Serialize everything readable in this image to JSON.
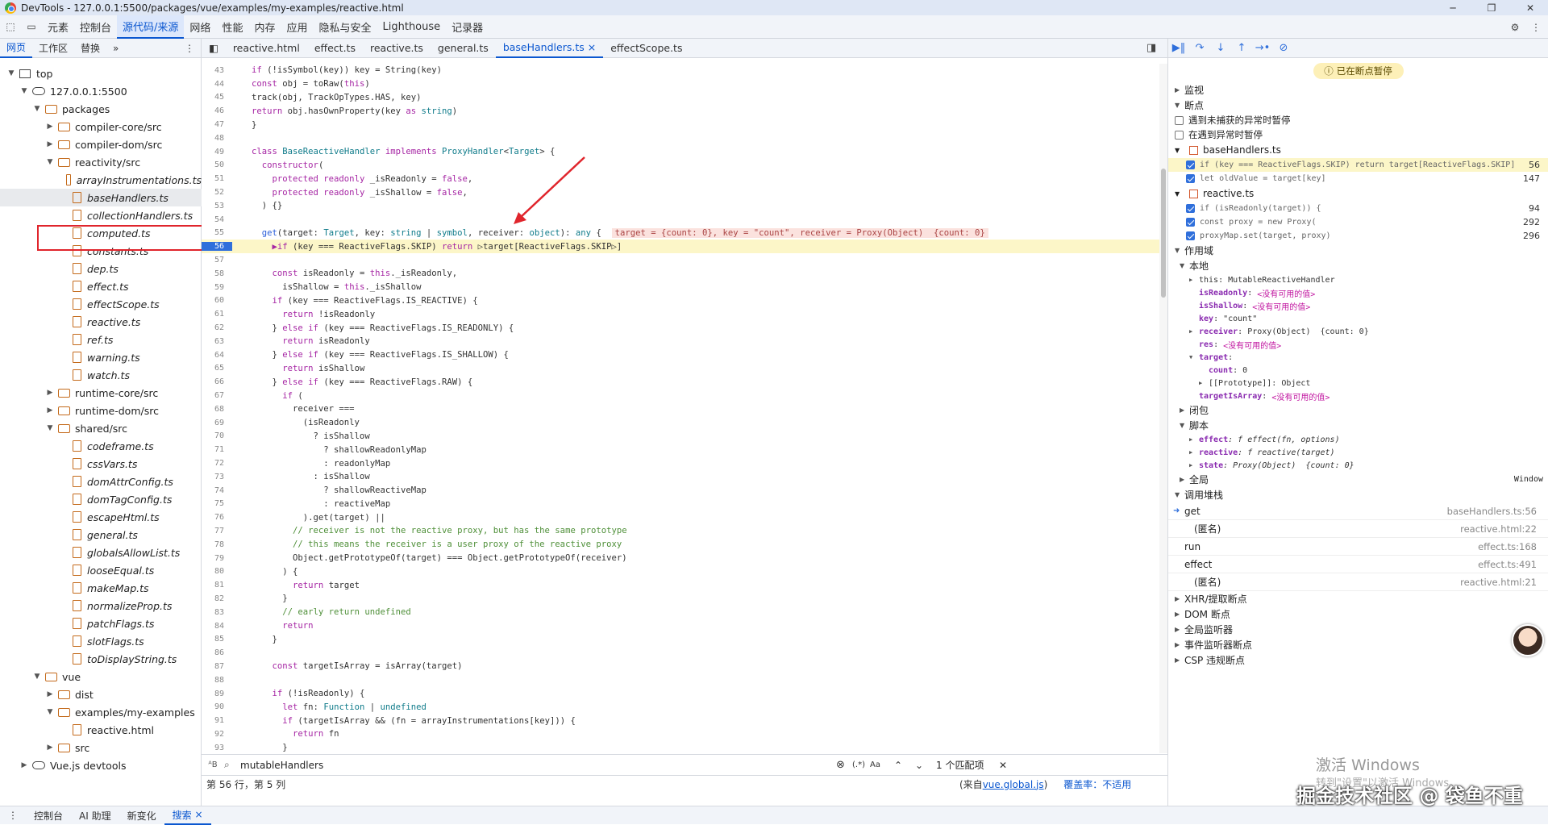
{
  "title": "DevTools - 127.0.0.1:5500/packages/vue/examples/my-examples/reactive.html",
  "main_tabs": [
    "元素",
    "控制台",
    "源代码/来源",
    "网络",
    "性能",
    "内存",
    "应用",
    "隐私与安全",
    "Lighthouse",
    "记录器"
  ],
  "sub_tabs": [
    "网页",
    "工作区",
    "替换"
  ],
  "tree": [
    {
      "label": "top",
      "depth": 0,
      "type": "frame",
      "arrow": "▼"
    },
    {
      "label": "127.0.0.1:5500",
      "depth": 1,
      "type": "cloud",
      "arrow": "▼"
    },
    {
      "label": "packages",
      "depth": 2,
      "type": "folder",
      "arrow": "▼"
    },
    {
      "label": "compiler-core/src",
      "depth": 3,
      "type": "folder",
      "arrow": "▶"
    },
    {
      "label": "compiler-dom/src",
      "depth": 3,
      "type": "folder",
      "arrow": "▶"
    },
    {
      "label": "reactivity/src",
      "depth": 3,
      "type": "folder",
      "arrow": "▼"
    },
    {
      "label": "arrayInstrumentations.ts",
      "depth": 4,
      "type": "file",
      "italic": true
    },
    {
      "label": "baseHandlers.ts",
      "depth": 4,
      "type": "file",
      "italic": true,
      "selected": true
    },
    {
      "label": "collectionHandlers.ts",
      "depth": 4,
      "type": "file",
      "italic": true
    },
    {
      "label": "computed.ts",
      "depth": 4,
      "type": "file",
      "italic": true
    },
    {
      "label": "constants.ts",
      "depth": 4,
      "type": "file",
      "italic": true
    },
    {
      "label": "dep.ts",
      "depth": 4,
      "type": "file",
      "italic": true
    },
    {
      "label": "effect.ts",
      "depth": 4,
      "type": "file",
      "italic": true
    },
    {
      "label": "effectScope.ts",
      "depth": 4,
      "type": "file",
      "italic": true
    },
    {
      "label": "reactive.ts",
      "depth": 4,
      "type": "file",
      "italic": true
    },
    {
      "label": "ref.ts",
      "depth": 4,
      "type": "file",
      "italic": true
    },
    {
      "label": "warning.ts",
      "depth": 4,
      "type": "file",
      "italic": true
    },
    {
      "label": "watch.ts",
      "depth": 4,
      "type": "file",
      "italic": true
    },
    {
      "label": "runtime-core/src",
      "depth": 3,
      "type": "folder",
      "arrow": "▶"
    },
    {
      "label": "runtime-dom/src",
      "depth": 3,
      "type": "folder",
      "arrow": "▶"
    },
    {
      "label": "shared/src",
      "depth": 3,
      "type": "folder",
      "arrow": "▼"
    },
    {
      "label": "codeframe.ts",
      "depth": 4,
      "type": "file",
      "italic": true
    },
    {
      "label": "cssVars.ts",
      "depth": 4,
      "type": "file",
      "italic": true
    },
    {
      "label": "domAttrConfig.ts",
      "depth": 4,
      "type": "file",
      "italic": true
    },
    {
      "label": "domTagConfig.ts",
      "depth": 4,
      "type": "file",
      "italic": true
    },
    {
      "label": "escapeHtml.ts",
      "depth": 4,
      "type": "file",
      "italic": true
    },
    {
      "label": "general.ts",
      "depth": 4,
      "type": "file",
      "italic": true
    },
    {
      "label": "globalsAllowList.ts",
      "depth": 4,
      "type": "file",
      "italic": true
    },
    {
      "label": "looseEqual.ts",
      "depth": 4,
      "type": "file",
      "italic": true
    },
    {
      "label": "makeMap.ts",
      "depth": 4,
      "type": "file",
      "italic": true
    },
    {
      "label": "normalizeProp.ts",
      "depth": 4,
      "type": "file",
      "italic": true
    },
    {
      "label": "patchFlags.ts",
      "depth": 4,
      "type": "file",
      "italic": true
    },
    {
      "label": "slotFlags.ts",
      "depth": 4,
      "type": "file",
      "italic": true
    },
    {
      "label": "toDisplayString.ts",
      "depth": 4,
      "type": "file",
      "italic": true
    },
    {
      "label": "vue",
      "depth": 2,
      "type": "folder",
      "arrow": "▼"
    },
    {
      "label": "dist",
      "depth": 3,
      "type": "folder",
      "arrow": "▶"
    },
    {
      "label": "examples/my-examples",
      "depth": 3,
      "type": "folder",
      "arrow": "▼"
    },
    {
      "label": "reactive.html",
      "depth": 4,
      "type": "file"
    },
    {
      "label": "src",
      "depth": 3,
      "type": "folder",
      "arrow": "▶"
    },
    {
      "label": "Vue.js devtools",
      "depth": 1,
      "type": "cloud",
      "arrow": "▶"
    }
  ],
  "editor_tabs": [
    {
      "label": "reactive.html"
    },
    {
      "label": "effect.ts"
    },
    {
      "label": "reactive.ts"
    },
    {
      "label": "general.ts"
    },
    {
      "label": "baseHandlers.ts",
      "active": true,
      "close": "×"
    },
    {
      "label": "effectScope.ts"
    }
  ],
  "code_lines": [
    {
      "n": "43",
      "html": "<span class=\"kw\">if</span> (!isSymbol(key)) key = String(key)"
    },
    {
      "n": "44",
      "html": "<span class=\"kw\">const</span> obj = toRaw(<span class=\"kw\">this</span>)"
    },
    {
      "n": "45",
      "html": "track(obj, TrackOpTypes.HAS, key)"
    },
    {
      "n": "46",
      "html": "<span class=\"kw\">return</span> obj.hasOwnProperty(key <span class=\"kw\">as</span> <span class=\"ty\">string</span>)"
    },
    {
      "n": "47",
      "html": "}"
    },
    {
      "n": "48",
      "html": ""
    },
    {
      "n": "49",
      "html": "<span class=\"kw\">class</span> <span class=\"ty\">BaseReactiveHandler</span> <span class=\"kw\">implements</span> <span class=\"ty\">ProxyHandler</span>&lt;<span class=\"ty\">Target</span>&gt; {"
    },
    {
      "n": "50",
      "html": "  <span class=\"kw\">constructor</span>("
    },
    {
      "n": "51",
      "html": "    <span class=\"kw\">protected readonly</span> _isReadonly = <span class=\"kw\">false</span>,"
    },
    {
      "n": "52",
      "html": "    <span class=\"kw\">protected readonly</span> _isShallow = <span class=\"kw\">false</span>,"
    },
    {
      "n": "53",
      "html": "  ) {}"
    },
    {
      "n": "54",
      "html": ""
    },
    {
      "n": "55",
      "html": "  <span class=\"fn\">get</span>(target: <span class=\"ty\">Target</span>, key: <span class=\"ty\">string</span> | <span class=\"ty\">symbol</span>, receiver: <span class=\"ty\">object</span>): <span class=\"ty\">any</span> {  <span class=\"inline\">target = {count: 0}, key = \"count\", receiver = Proxy(Object)  {count: 0}</span>"
    },
    {
      "n": "56",
      "html": "    <span class=\"kw\">▶if</span> (key === ReactiveFlags.SKIP) <span class=\"kw\">return</span> ▷target[ReactiveFlags.SKIP▷]",
      "cur": true
    },
    {
      "n": "57",
      "html": ""
    },
    {
      "n": "58",
      "html": "    <span class=\"kw\">const</span> isReadonly = <span class=\"kw\">this</span>._isReadonly,"
    },
    {
      "n": "59",
      "html": "      isShallow = <span class=\"kw\">this</span>._isShallow"
    },
    {
      "n": "60",
      "html": "    <span class=\"kw\">if</span> (key === ReactiveFlags.IS_REACTIVE) {"
    },
    {
      "n": "61",
      "html": "      <span class=\"kw\">return</span> !isReadonly"
    },
    {
      "n": "62",
      "html": "    } <span class=\"kw\">else if</span> (key === ReactiveFlags.IS_READONLY) {"
    },
    {
      "n": "63",
      "html": "      <span class=\"kw\">return</span> isReadonly"
    },
    {
      "n": "64",
      "html": "    } <span class=\"kw\">else if</span> (key === ReactiveFlags.IS_SHALLOW) {"
    },
    {
      "n": "65",
      "html": "      <span class=\"kw\">return</span> isShallow"
    },
    {
      "n": "66",
      "html": "    } <span class=\"kw\">else if</span> (key === ReactiveFlags.RAW) {"
    },
    {
      "n": "67",
      "html": "      <span class=\"kw\">if</span> ("
    },
    {
      "n": "68",
      "html": "        receiver ==="
    },
    {
      "n": "69",
      "html": "          (isReadonly"
    },
    {
      "n": "70",
      "html": "            ? isShallow"
    },
    {
      "n": "71",
      "html": "              ? shallowReadonlyMap"
    },
    {
      "n": "72",
      "html": "              : readonlyMap"
    },
    {
      "n": "73",
      "html": "            : isShallow"
    },
    {
      "n": "74",
      "html": "              ? shallowReactiveMap"
    },
    {
      "n": "75",
      "html": "              : reactiveMap"
    },
    {
      "n": "76",
      "html": "          ).get(target) ||"
    },
    {
      "n": "77",
      "html": "        <span class=\"cm\">// receiver is not the reactive proxy, but has the same prototype</span>"
    },
    {
      "n": "78",
      "html": "        <span class=\"cm\">// this means the receiver is a user proxy of the reactive proxy</span>"
    },
    {
      "n": "79",
      "html": "        Object.getPrototypeOf(target) === Object.getPrototypeOf(receiver)"
    },
    {
      "n": "80",
      "html": "      ) {"
    },
    {
      "n": "81",
      "html": "        <span class=\"kw\">return</span> target"
    },
    {
      "n": "82",
      "html": "      }"
    },
    {
      "n": "83",
      "html": "      <span class=\"cm\">// early return undefined</span>"
    },
    {
      "n": "84",
      "html": "      <span class=\"kw\">return</span>"
    },
    {
      "n": "85",
      "html": "    }"
    },
    {
      "n": "86",
      "html": ""
    },
    {
      "n": "87",
      "html": "    <span class=\"kw\">const</span> targetIsArray = isArray(target)"
    },
    {
      "n": "88",
      "html": ""
    },
    {
      "n": "89",
      "html": "    <span class=\"kw\">if</span> (!isReadonly) {"
    },
    {
      "n": "90",
      "html": "      <span class=\"kw\">let</span> fn: <span class=\"ty\">Function</span> | <span class=\"ty\">undefined</span>"
    },
    {
      "n": "91",
      "html": "      <span class=\"kw\">if</span> (targetIsArray &amp;&amp; (fn = arrayInstrumentations[key])) {"
    },
    {
      "n": "92",
      "html": "        <span class=\"kw\">return</span> fn"
    },
    {
      "n": "93",
      "html": "      }"
    }
  ],
  "search": {
    "value": "mutableHandlers",
    "match_count": "1 个匹配项",
    "aa": "Aa",
    "regex": "(.*)"
  },
  "status": {
    "position": "第 56 行，第 5 列",
    "source_prefix": "(来自 ",
    "source_link": "vue.global.js",
    "source_suffix": ")",
    "coverage": "覆盖率：不适用"
  },
  "right": {
    "paused_label": "已在断点暂停",
    "sections": {
      "watch": "监视",
      "breakpoints": "断点",
      "scope": "作用域",
      "local": "本地",
      "closure": "闭包",
      "script": "脚本",
      "global": "全局",
      "global_val": "Window",
      "callstack": "调用堆栈",
      "xhr": "XHR/提取断点",
      "dom": "DOM 断点",
      "globallisteners": "全局监听器",
      "eventlisteners": "事件监听器断点",
      "csp": "CSP 违规断点"
    },
    "pause_uncaught": "遇到未捕获的异常时暂停",
    "pause_caught": "在遇到异常时暂停",
    "bp_files": [
      {
        "file": "baseHandlers.ts",
        "lines": [
          {
            "code": "if (key === ReactiveFlags.SKIP) return target[ReactiveFlags.SKIP]",
            "num": "56",
            "hl": true
          },
          {
            "code": "let oldValue = target[key]",
            "num": "147"
          }
        ]
      },
      {
        "file": "reactive.ts",
        "lines": [
          {
            "code": "if (isReadonly(target)) {",
            "num": "94"
          },
          {
            "code": "const proxy = new Proxy(",
            "num": "292"
          },
          {
            "code": "proxyMap.set(target, proxy)",
            "num": "296"
          }
        ]
      }
    ],
    "scope_lines": [
      {
        "indent": 1,
        "arr": "▶",
        "k": "this",
        "v": ": MutableReactiveHandler",
        "kcls": "k2"
      },
      {
        "indent": 1,
        "k": "isReadonly",
        "v": ": ",
        "nv": "<没有可用的值>"
      },
      {
        "indent": 1,
        "k": "isShallow",
        "v": ": ",
        "nv": "<没有可用的值>"
      },
      {
        "indent": 1,
        "k": "key",
        "v": ": \"count\""
      },
      {
        "indent": 1,
        "arr": "▶",
        "k": "receiver",
        "v": ": Proxy(Object)  {count: 0}"
      },
      {
        "indent": 1,
        "k": "res",
        "v": ": ",
        "nv": "<没有可用的值>"
      },
      {
        "indent": 1,
        "arr": "▼",
        "k": "target",
        "v": ":"
      },
      {
        "indent": 2,
        "k": "count",
        "v": ": 0"
      },
      {
        "indent": 2,
        "arr": "▶",
        "k": "[[Prototype]]",
        "v": ": Object",
        "kcls": "k2"
      },
      {
        "indent": 1,
        "k": "targetIsArray",
        "v": ": ",
        "nv": "<没有可用的值>"
      }
    ],
    "script_lines": [
      {
        "k": "effect",
        "v": ": f effect(fn, options)"
      },
      {
        "k": "reactive",
        "v": ": f reactive(target)"
      },
      {
        "k": "state",
        "v": ": Proxy(Object)  {count: 0}"
      }
    ],
    "stack": [
      {
        "name": "get",
        "loc": "baseHandlers.ts:56",
        "current": true
      },
      {
        "name": "(匿名)",
        "loc": "reactive.html:22"
      },
      {
        "name": "run",
        "loc": "effect.ts:168"
      },
      {
        "name": "effect",
        "loc": "effect.ts:491"
      },
      {
        "name": "(匿名)",
        "loc": "reactive.html:21"
      }
    ]
  },
  "bottom_tabs": [
    "控制台",
    "AI 助理",
    "新变化",
    "搜索"
  ],
  "watermarks": {
    "activate": "激活 Windows",
    "activate_sub": "转到\"设置\"以激活 Windows。",
    "brand": "掘金技术社区 @ 袋鱼不重"
  }
}
